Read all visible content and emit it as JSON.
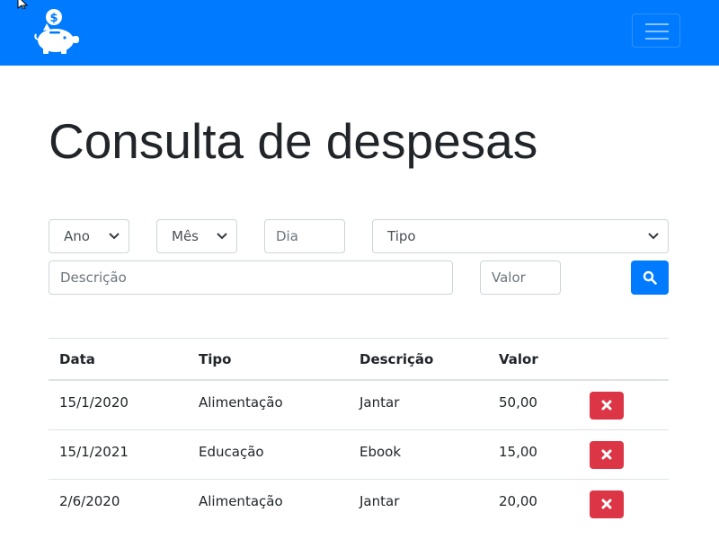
{
  "navbar": {
    "logo_icon": "piggy-bank-dollar-icon",
    "toggler_icon": "hamburger-menu-icon",
    "color": "#007bff"
  },
  "page": {
    "title": "Consulta de despesas"
  },
  "filters": {
    "ano": {
      "value": "Ano"
    },
    "mes": {
      "value": "Mês"
    },
    "dia": {
      "placeholder": "Dia"
    },
    "tipo": {
      "value": "Tipo"
    },
    "descricao": {
      "placeholder": "Descrição"
    },
    "valor": {
      "placeholder": "Valor"
    },
    "search_icon": "search-icon"
  },
  "table": {
    "headers": [
      "Data",
      "Tipo",
      "Descrição",
      "Valor"
    ],
    "rows": [
      {
        "data": "15/1/2020",
        "tipo": "Alimentação",
        "descricao": "Jantar",
        "valor": "50,00"
      },
      {
        "data": "15/1/2021",
        "tipo": "Educação",
        "descricao": "Ebook",
        "valor": "15,00"
      },
      {
        "data": "2/6/2020",
        "tipo": "Alimentação",
        "descricao": "Jantar",
        "valor": "20,00"
      }
    ],
    "delete_icon": "close-icon",
    "delete_color": "#dc3545"
  }
}
